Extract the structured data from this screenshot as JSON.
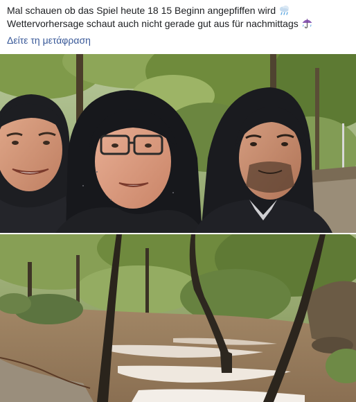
{
  "post": {
    "text_line_1": "Mal schauen ob das Spiel heute 18 15 Beginn angepfiffen wird",
    "text_line_2": "Wettervorhersage schaut auch nicht gerade gut aus für nachmittags",
    "emoji_1": "rain-cloud-icon",
    "emoji_2": "umbrella-rain-icon",
    "translate_link": "Δείτε τη μετάφραση"
  },
  "photos": [
    {
      "name": "selfie-photo",
      "subject": "three-men-in-hoods-selfie"
    },
    {
      "name": "flood-photo",
      "subject": "flooded-park-stream"
    }
  ],
  "colors": {
    "text": "#1c1e21",
    "link": "#385898",
    "foliage": "#6f8b3c",
    "floodwater": "#9a8064"
  }
}
